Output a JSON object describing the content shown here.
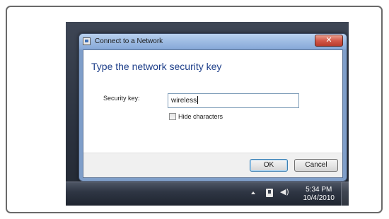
{
  "dialog": {
    "title": "Connect to a Network",
    "close_glyph": "✕",
    "heading": "Type the network security key",
    "security_key_label": "Security key:",
    "security_key_value": "wireless",
    "hide_characters_label": "Hide characters",
    "hide_characters_checked": false,
    "ok_label": "OK",
    "cancel_label": "Cancel"
  },
  "taskbar": {
    "time": "5:34 PM",
    "date": "10/4/2010",
    "tray_icons": [
      "show-hidden-icons-arrow-icon",
      "network-icon",
      "volume-icon"
    ],
    "volume_glyph": "◀)"
  },
  "colors": {
    "heading": "#1e3f8a",
    "close_button": "#c94a3b",
    "ok_border": "#3c7fb1"
  }
}
